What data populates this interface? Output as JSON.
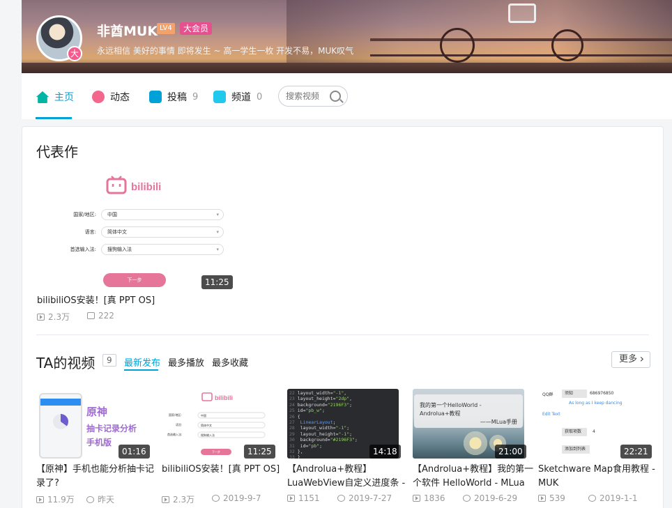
{
  "header": {
    "username": "非酋MUK",
    "level": "LV4",
    "vip_label": "大会员",
    "vip_badge_char": "大",
    "signature": "永远相信 美好的事情 即将发生 ~ 高一学生一枚 开发不易，MUK叹气"
  },
  "nav": {
    "tabs": [
      {
        "label": "主页",
        "count": "",
        "icon": "home-icon",
        "color": "#00b5a3"
      },
      {
        "label": "动态",
        "count": "",
        "icon": "dynamic-icon",
        "color": "#f3678c"
      },
      {
        "label": "投稿",
        "count": "9",
        "icon": "upload-icon",
        "color": "#00a1d6"
      },
      {
        "label": "频道",
        "count": "0",
        "icon": "channel-icon",
        "color": "#23c9ed"
      }
    ],
    "search_placeholder": "搜索视频"
  },
  "masterpiece": {
    "section_title": "代表作",
    "thumb": {
      "logo_text": "bilibili",
      "rows": [
        {
          "label": "国家/地区:",
          "value": "中国"
        },
        {
          "label": "语言:",
          "value": "简体中文"
        },
        {
          "label": "首选输入法:",
          "value": "搜狗输入法"
        }
      ],
      "button": "下一步"
    },
    "duration": "11:25",
    "title": "bilibiliOS安装！[真 PPT OS]",
    "plays": "2.3万",
    "danmaku": "222"
  },
  "videos_section": {
    "title": "TA的视频",
    "count": "9",
    "sort_tabs": [
      "最新发布",
      "最多播放",
      "最多收藏"
    ],
    "more": "更多"
  },
  "videos": [
    {
      "duration": "01:16",
      "title_line1": "【原神】手机也能分析抽卡记",
      "title_line2": "录了?",
      "plays": "11.9万",
      "date": "昨天",
      "thumb_text": [
        "原神",
        "抽卡记录分析",
        "手机版"
      ]
    },
    {
      "duration": "11:25",
      "title_line1": "bilibiliOS安装！[真 PPT OS]",
      "title_line2": "",
      "plays": "2.3万",
      "date": "2019-9-7",
      "thumb_text": [
        "bilibili",
        "国家/地区:",
        "中国",
        "语言:",
        "简体中文",
        "首选输入法:",
        "搜狗输入法",
        "下一步"
      ]
    },
    {
      "duration": "14:18",
      "title_line1": "【Androlua+教程】",
      "title_line2": "LuaWebView自定义进度条 -",
      "plays": "1151",
      "date": "2019-7-27",
      "thumb_text": []
    },
    {
      "duration": "21:00",
      "title_line1": "【Androlua+教程】我的第一",
      "title_line2": "个软件 HelloWorld - MLua",
      "plays": "1836",
      "date": "2019-6-29",
      "thumb_text": [
        "我的第一个HelloWorld - Androlua+教程",
        "——MLua手册"
      ]
    },
    {
      "duration": "22:21",
      "title_line1": "Sketchware Map食用教程 -",
      "title_line2": "MUK",
      "plays": "539",
      "date": "2019-1-1",
      "thumb_text": [
        "QQ群",
        "须知",
        "686976850",
        "As long as I keep dancing",
        "Edit Text",
        "获取项数",
        "4",
        "添加到列表"
      ]
    }
  ]
}
